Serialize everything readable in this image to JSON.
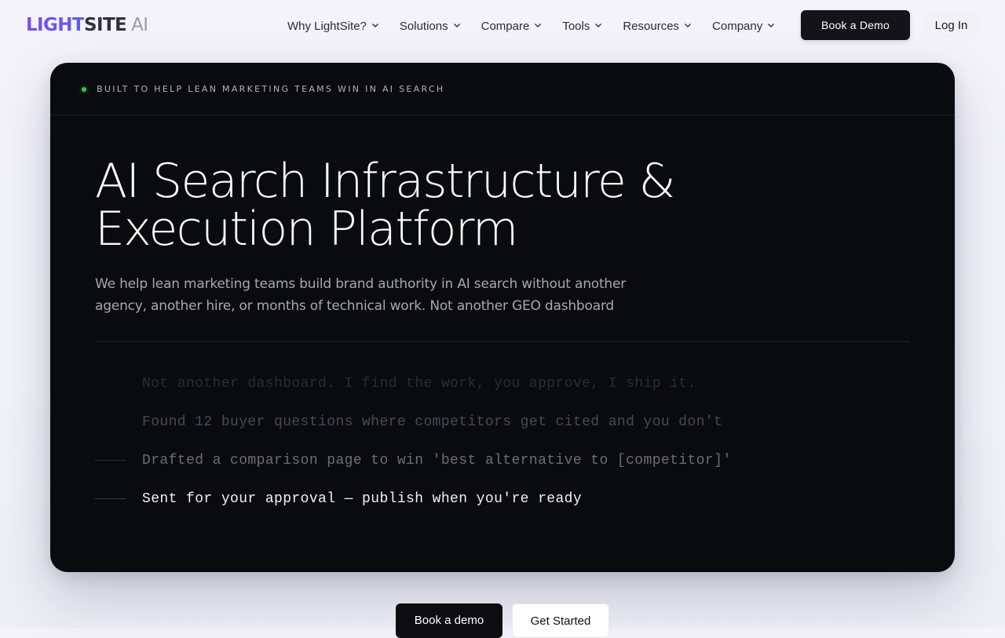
{
  "brand": {
    "part1": "LIGHT",
    "part2": "SITE",
    "part3": "AI"
  },
  "nav": {
    "items": [
      {
        "label": "Why LightSite?"
      },
      {
        "label": "Solutions"
      },
      {
        "label": "Compare"
      },
      {
        "label": "Tools"
      },
      {
        "label": "Resources"
      },
      {
        "label": "Company"
      }
    ],
    "demo_button": "Book a Demo",
    "login_button": "Log In"
  },
  "hero": {
    "badge": "BUILT TO HELP LEAN MARKETING TEAMS WIN IN AI SEARCH",
    "headline_line1": "AI Search Infrastructure &",
    "headline_line2": "Execution Platform",
    "subtext": "We help lean marketing teams build brand authority in AI search without another agency, another hire, or months of technical work. Not another GEO dashboard",
    "log_lines": [
      "Not another dashboard. I find the work, you approve, I ship it.",
      "Found 12 buyer questions where competitors get cited and you don't",
      "Drafted a comparison page to win 'best alternative to [competitor]'",
      "Sent for your approval — publish when you're ready"
    ]
  },
  "cta": {
    "primary": "Book a demo",
    "secondary": "Get Started"
  },
  "colors": {
    "card_bg": "#0a0b0f",
    "status_dot": "#35c256",
    "logo_gradient_start": "#7a4df0",
    "logo_gradient_end": "#5b5fe8",
    "button_dark": "#141418"
  }
}
